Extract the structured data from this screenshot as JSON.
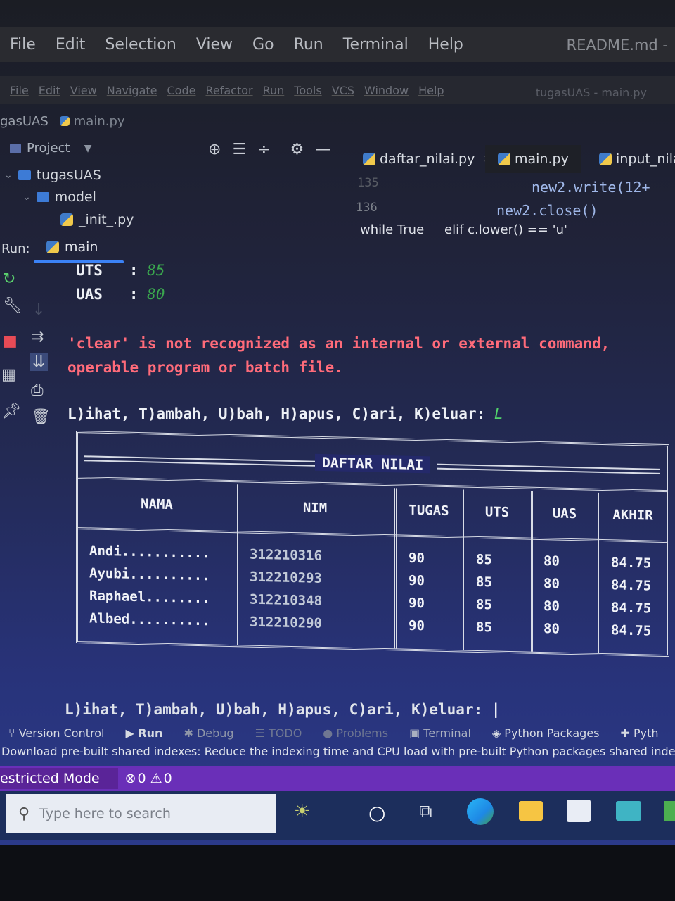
{
  "vscode": {
    "menu": [
      "File",
      "Edit",
      "Selection",
      "View",
      "Go",
      "Run",
      "Terminal",
      "Help"
    ],
    "title": "README.md -"
  },
  "pycharm": {
    "menu": [
      "File",
      "Edit",
      "View",
      "Navigate",
      "Code",
      "Refactor",
      "Run",
      "Tools",
      "VCS",
      "Window",
      "Help"
    ],
    "project_title": "tugasUAS - main.py",
    "breadcrumb": {
      "project": "gasUAS",
      "file": "main.py"
    },
    "project_panel": {
      "header": "Project",
      "tree": [
        {
          "label": "tugasUAS",
          "type": "folder",
          "level": 0
        },
        {
          "label": "model",
          "type": "folder",
          "level": 1
        },
        {
          "label": "_init_.py",
          "type": "file",
          "level": 2
        }
      ]
    },
    "tabs": [
      "daftar_nilai.py",
      "main.py",
      "input_nilai"
    ],
    "editor": {
      "lines": [
        {
          "num": "135",
          "code": "new2.write(12+"
        },
        {
          "num": "136",
          "code": "new2.close()"
        }
      ],
      "scope_crumbs": [
        "while True",
        "elif c.lower() == 'u'"
      ]
    },
    "run": {
      "label": "Run:",
      "tab": "main"
    }
  },
  "console": {
    "uts_line": "UTS   : ",
    "uts_value": "85",
    "uas_line": "UAS   : ",
    "uas_value": "80",
    "error_line1": "'clear' is not recognized as an internal or external command,",
    "error_line2": "operable program or batch file.",
    "prompt1": "L)ihat, T)ambah, U)bah, H)apus, C)ari, K)eluar: ",
    "prompt1_input": "L",
    "prompt2": "L)ihat, T)ambah, U)bah, H)apus, C)ari, K)eluar: "
  },
  "table": {
    "title": "DAFTAR NILAI",
    "headers": [
      "NAMA",
      "NIM",
      "TUGAS",
      "UTS",
      "UAS",
      "AKHIR"
    ],
    "rows": [
      {
        "nama": "Andi...........",
        "nim": "312210316",
        "tugas": "90",
        "uts": "85",
        "uas": "80",
        "akhir": "84.75"
      },
      {
        "nama": "Ayubi..........",
        "nim": "312210293",
        "tugas": "90",
        "uts": "85",
        "uas": "80",
        "akhir": "84.75"
      },
      {
        "nama": "Raphael........",
        "nim": "312210348",
        "tugas": "90",
        "uts": "85",
        "uas": "80",
        "akhir": "84.75"
      },
      {
        "nama": "Albed..........",
        "nim": "312210290",
        "tugas": "90",
        "uts": "85",
        "uas": "80",
        "akhir": "84.75"
      }
    ]
  },
  "tool_tabs": [
    "Version Control",
    "Run",
    "Debug",
    "TODO",
    "Problems",
    "Terminal",
    "Python Packages",
    "Pyth"
  ],
  "notification": "Download pre-built shared indexes: Reduce the indexing time and CPU load with pre-built Python packages shared indexes /",
  "vs_status": {
    "mode": "estricted Mode",
    "errors": "0",
    "warnings": "0"
  },
  "taskbar": {
    "search_placeholder": "Type here to search"
  }
}
